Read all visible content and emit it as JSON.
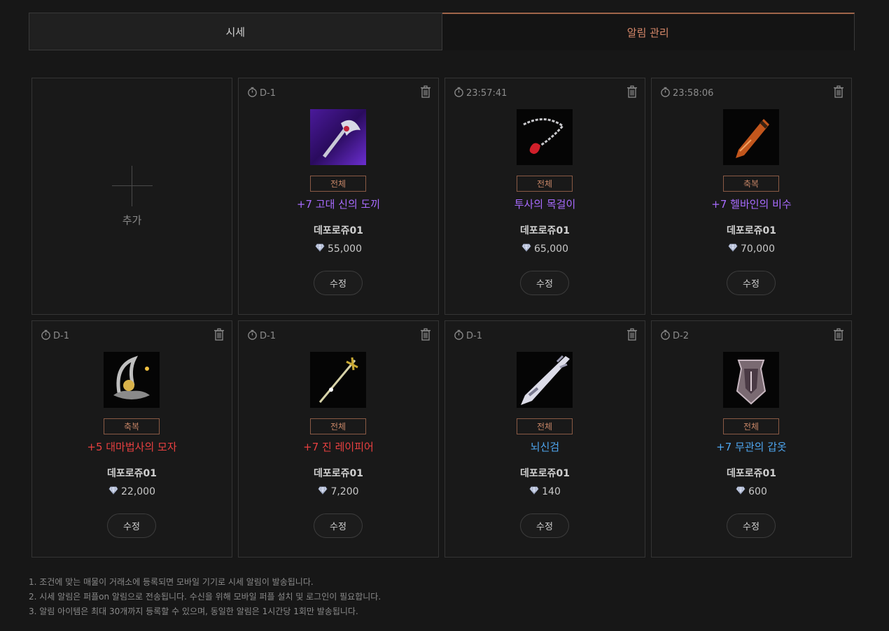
{
  "tabs": [
    {
      "label": "시세",
      "active": false
    },
    {
      "label": "알림 관리",
      "active": true
    }
  ],
  "add_card": {
    "label": "추가"
  },
  "edit_label": "수정",
  "cards": [
    {
      "timer": "D-1",
      "tag": "전체",
      "name": "+7 고대 신의 도끼",
      "name_color": "#a86bff",
      "seller": "데포로쥬01",
      "price": "55,000",
      "icon": "axe-icon"
    },
    {
      "timer": "23:57:41",
      "tag": "전체",
      "name": "투사의 목걸이",
      "name_color": "#a86bff",
      "seller": "데포로쥬01",
      "price": "65,000",
      "icon": "necklace-icon"
    },
    {
      "timer": "23:58:06",
      "tag": "축복",
      "name": "+7 헬바인의 비수",
      "name_color": "#a86bff",
      "seller": "데포로쥬01",
      "price": "70,000",
      "icon": "dagger-icon"
    },
    {
      "timer": "D-1",
      "tag": "축복",
      "name": "+5 대마법사의 모자",
      "name_color": "#e84040",
      "seller": "데포로쥬01",
      "price": "22,000",
      "icon": "hat-icon"
    },
    {
      "timer": "D-1",
      "tag": "전체",
      "name": "+7 진 레이피어",
      "name_color": "#e84040",
      "seller": "데포로쥬01",
      "price": "7,200",
      "icon": "rapier-icon"
    },
    {
      "timer": "D-1",
      "tag": "전체",
      "name": "뇌신검",
      "name_color": "#4ea6f0",
      "seller": "데포로쥬01",
      "price": "140",
      "icon": "sword-icon"
    },
    {
      "timer": "D-2",
      "tag": "전체",
      "name": "+7 무관의 갑옷",
      "name_color": "#4ea6f0",
      "seller": "데포로쥬01",
      "price": "600",
      "icon": "armor-icon"
    }
  ],
  "notes": [
    "1. 조건에 맞는 매물이 거래소에 등록되면 모바일 기기로 시세 알림이 발송됩니다.",
    "2. 시세 알림은 퍼플on 알림으로 전송됩니다. 수신을 위해 모바일 퍼플 설치 및 로그인이 필요합니다.",
    "3. 알림 아이템은 최대 30개까지 등록할 수 있으며, 동일한 알림은 1시간당 1회만 발송됩니다."
  ]
}
